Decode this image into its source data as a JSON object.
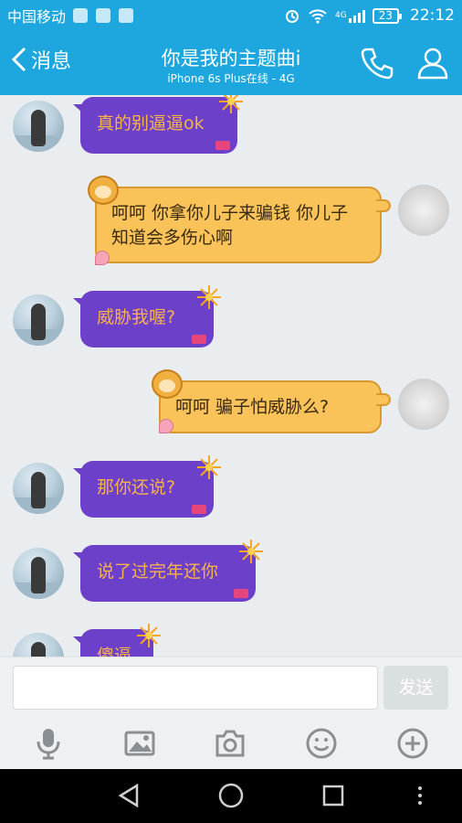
{
  "status_bar": {
    "carrier": "中国移动",
    "network": "4G",
    "battery": "23",
    "time": "22:12"
  },
  "header": {
    "back_label": "消息",
    "title": "你是我的主题曲i",
    "subtitle": "iPhone 6s Plus在线 - 4G",
    "call_icon": "phone-icon",
    "profile_icon": "person-icon"
  },
  "messages": [
    {
      "side": "left",
      "text": "真的别逼逼ok"
    },
    {
      "side": "right",
      "text": "呵呵 你拿你儿子来骗钱 你儿子知道会多伤心啊"
    },
    {
      "side": "left",
      "text": "威胁我喔?"
    },
    {
      "side": "right",
      "text": "呵呵 骗子怕威胁么?"
    },
    {
      "side": "left",
      "text": "那你还说?"
    },
    {
      "side": "left",
      "text": "说了过完年还你"
    },
    {
      "side": "left",
      "text": "傻逼"
    }
  ],
  "input": {
    "value": "",
    "placeholder": "",
    "send_label": "发送"
  },
  "toolbar": {
    "items": [
      "microphone-icon",
      "image-icon",
      "camera-icon",
      "emoji-icon",
      "plus-icon"
    ]
  },
  "colors": {
    "header": "#1ea7df",
    "bubble_purple": "#6c40c9",
    "bubble_purple_text": "#f7b24e",
    "bubble_yellow": "#f9c35a",
    "chat_bg": "#e9edf0"
  }
}
